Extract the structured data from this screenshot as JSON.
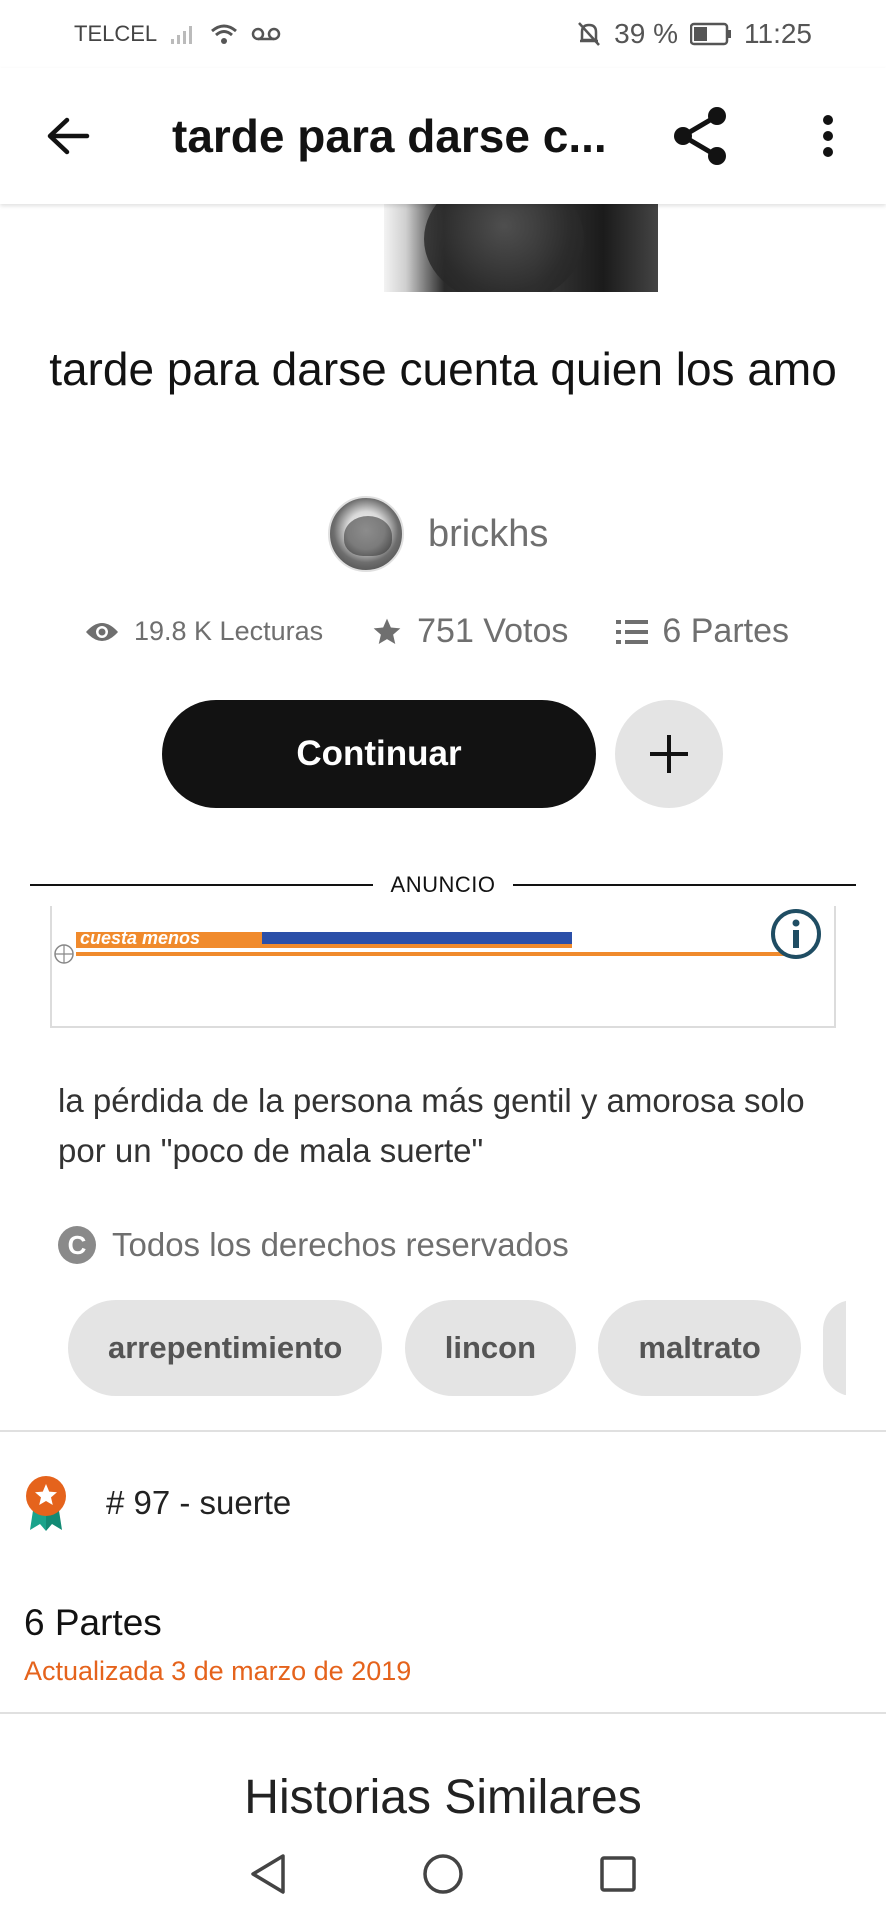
{
  "status_bar": {
    "carrier": "TELCEL",
    "battery_percent": "39 %",
    "time": "11:25"
  },
  "app_bar": {
    "title": "tarde para darse c..."
  },
  "story": {
    "title": "tarde para darse cuenta quien los amo",
    "author": "brickhs",
    "reads": "19.8 K Lecturas",
    "votes": "751 Votos",
    "parts": "6 Partes",
    "continue_label": "Continuar",
    "description": "la pérdida de la persona más gentil y amorosa solo por un \"poco de mala suerte\"",
    "copyright": "Todos los derechos reservados"
  },
  "ad": {
    "label": "ANUNCIO",
    "banner_text": "cuesta menos"
  },
  "tags": [
    {
      "label": "arrepentimiento"
    },
    {
      "label": "lincon"
    },
    {
      "label": "maltrato"
    }
  ],
  "ranking": {
    "text": "# 97 - suerte"
  },
  "parts_section": {
    "title": "6 Partes",
    "updated": "Actualizada 3 de marzo de 2019"
  },
  "similar": {
    "heading": "Historias Similares"
  },
  "colors": {
    "accent_orange": "#e5631c",
    "primary_button": "#121212",
    "chip_bg": "#e4e4e4"
  }
}
